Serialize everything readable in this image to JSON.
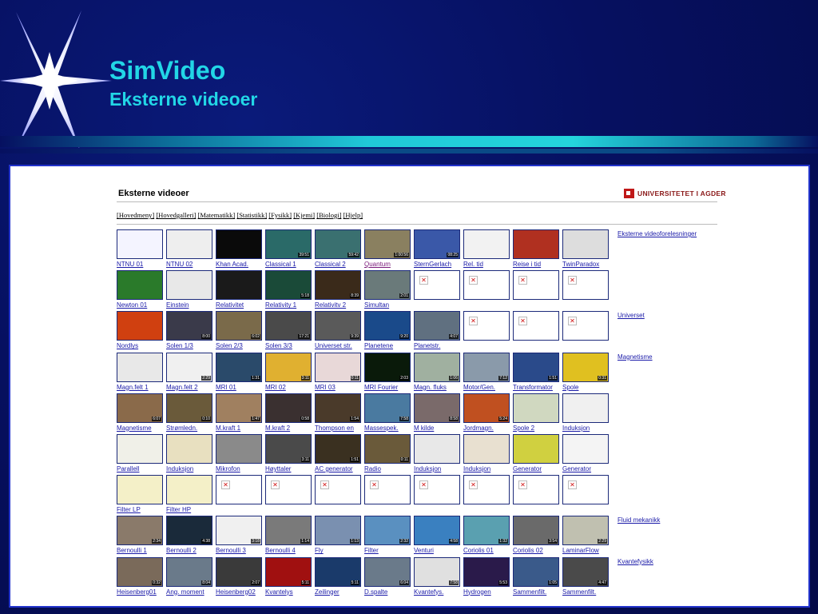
{
  "slide": {
    "title": "SimVideo",
    "subtitle": "Eksterne videoer"
  },
  "page": {
    "heading": "Eksterne videoer",
    "logo_text": "UNIVERSITETET I AGDER",
    "nav": [
      "[Hovedmeny]",
      "[Hovedgalleri]",
      "[Matematikk]",
      "[Statistikk]",
      "[Fysikk]",
      "[Kjemi]",
      "[Biologi]",
      "[Hjelp]"
    ]
  },
  "rows": [
    {
      "side": "Eksterne videoforelesninger",
      "items": [
        {
          "label": "NTNU 01",
          "bg": "#f4f4ff",
          "dur": ""
        },
        {
          "label": "NTNU 02",
          "bg": "#eeeeee",
          "dur": ""
        },
        {
          "label": "Khan Acad.",
          "bg": "#0a0a0a",
          "dur": ""
        },
        {
          "label": "Classical 1",
          "bg": "#2a6a68",
          "dur": "39:51"
        },
        {
          "label": "Classical 2",
          "bg": "#3a7070",
          "dur": "59:42"
        },
        {
          "label": "Quantum",
          "bg": "#8a8060",
          "dur": "1:00:56",
          "visited": true
        },
        {
          "label": "SternGerlach",
          "bg": "#3a58a8",
          "dur": "08:25"
        },
        {
          "label": "Rel. tid",
          "bg": "#f2f2f2",
          "dur": ""
        },
        {
          "label": "Reise i tid",
          "bg": "#b03020",
          "dur": ""
        },
        {
          "label": "TwinParadox",
          "bg": "#dddddd",
          "dur": ""
        }
      ]
    },
    {
      "side": "",
      "items": [
        {
          "label": "Newton 01",
          "bg": "#2a7a2a",
          "dur": ""
        },
        {
          "label": "Einstein",
          "bg": "#e8e8e8",
          "dur": ""
        },
        {
          "label": "Relativitet",
          "bg": "#1a1a1a",
          "dur": ""
        },
        {
          "label": "Relativity 1",
          "bg": "#1a4a38",
          "dur": "5:18"
        },
        {
          "label": "Relativitv 2",
          "bg": "#3a2a1a",
          "dur": "8:39"
        },
        {
          "label": "Simultan",
          "bg": "#6a7a7a",
          "dur": "2:01"
        },
        {
          "label": "",
          "bg": "",
          "dur": ""
        },
        {
          "label": "",
          "bg": "",
          "dur": ""
        },
        {
          "label": "",
          "bg": "",
          "dur": ""
        },
        {
          "label": "",
          "bg": "",
          "dur": ""
        }
      ]
    },
    {
      "side": "Universet",
      "items": [
        {
          "label": "Nordlys",
          "bg": "#d04010",
          "dur": ""
        },
        {
          "label": "Solen 1/3",
          "bg": "#3a3a4a",
          "dur": "8:00"
        },
        {
          "label": "Solen 2/3",
          "bg": "#7a6a4a",
          "dur": "6:02"
        },
        {
          "label": "Solen 3/3",
          "bg": "#4a4a4a",
          "dur": "17:21"
        },
        {
          "label": "Universet str.",
          "bg": "#5a5a5a",
          "dur": "9:39"
        },
        {
          "label": "Planetene",
          "bg": "#1a4a8a",
          "dur": "9:20"
        },
        {
          "label": "Planetstr.",
          "bg": "#607080",
          "dur": "4:07"
        },
        {
          "label": "",
          "bg": "",
          "dur": ""
        },
        {
          "label": "",
          "bg": "",
          "dur": ""
        },
        {
          "label": "",
          "bg": "",
          "dur": ""
        }
      ]
    },
    {
      "side": "Magnetisme",
      "items": [
        {
          "label": "Magn.felt 1",
          "bg": "#e8e8e8",
          "dur": ""
        },
        {
          "label": "Magn.felt 2",
          "bg": "#f0f0f0",
          "dur": "2:29"
        },
        {
          "label": "MRI 01",
          "bg": "#2a4a6a",
          "dur": "1:31"
        },
        {
          "label": "MRI 02",
          "bg": "#e0b030",
          "dur": "3:11"
        },
        {
          "label": "MRI 03",
          "bg": "#e8d8d8",
          "dur": "0:11"
        },
        {
          "label": "MRI Fourier",
          "bg": "#0a1a0a",
          "dur": "2:03"
        },
        {
          "label": "Magn. fluks",
          "bg": "#a0b0a0",
          "dur": "1:06"
        },
        {
          "label": "Motor/Gen.",
          "bg": "#8a9aaa",
          "dur": "7:12"
        },
        {
          "label": "Transformator",
          "bg": "#2a4a8a",
          "dur": "1:51"
        },
        {
          "label": "Spole",
          "bg": "#e0c020",
          "dur": "0:31"
        }
      ]
    },
    {
      "side": "",
      "items": [
        {
          "label": "Magnetisme",
          "bg": "#8a6a4a",
          "dur": "6:07"
        },
        {
          "label": "Strømledn.",
          "bg": "#6a5a3a",
          "dur": "0:10"
        },
        {
          "label": "M.kraft 1",
          "bg": "#a08060",
          "dur": "1:47"
        },
        {
          "label": "M.kraft 2",
          "bg": "#3a3030",
          "dur": "0:58"
        },
        {
          "label": "Thompson en",
          "bg": "#4a3a2a",
          "dur": "1:54"
        },
        {
          "label": "Massespek.",
          "bg": "#4a7aa0",
          "dur": "7:58"
        },
        {
          "label": "M kilde",
          "bg": "#7a6a6a",
          "dur": "8:58"
        },
        {
          "label": "Jordmagn.",
          "bg": "#c05020",
          "dur": "5:24"
        },
        {
          "label": "Spole 2",
          "bg": "#d0d8c0",
          "dur": ""
        },
        {
          "label": "Induksjon",
          "bg": "#f0f0f0",
          "dur": ""
        }
      ]
    },
    {
      "side": "",
      "items": [
        {
          "label": "Parallell",
          "bg": "#f0f0e8",
          "dur": ""
        },
        {
          "label": "Induksjon",
          "bg": "#e8e0c0",
          "dur": ""
        },
        {
          "label": "Mikrofon",
          "bg": "#8a8a8a",
          "dur": ""
        },
        {
          "label": "Høyttaler",
          "bg": "#4a4a4a",
          "dur": "3:11"
        },
        {
          "label": "AC generator",
          "bg": "#3a3020",
          "dur": "1:51"
        },
        {
          "label": "Radio",
          "bg": "#6a5a3a",
          "dur": "0:11"
        },
        {
          "label": "Induksjon",
          "bg": "#e8e8e8",
          "dur": ""
        },
        {
          "label": "Induksjon",
          "bg": "#e8e0d0",
          "dur": ""
        },
        {
          "label": "Generator",
          "bg": "#d0d040",
          "dur": ""
        },
        {
          "label": "Generator",
          "bg": "#f4f4f4",
          "dur": ""
        }
      ]
    },
    {
      "side": "",
      "items": [
        {
          "label": "Filter LP",
          "bg": "#f4f0c8",
          "dur": ""
        },
        {
          "label": "Filter HP",
          "bg": "#f4f0c8",
          "dur": ""
        },
        {
          "label": "",
          "bg": "",
          "dur": ""
        },
        {
          "label": "",
          "bg": "",
          "dur": ""
        },
        {
          "label": "",
          "bg": "",
          "dur": ""
        },
        {
          "label": "",
          "bg": "",
          "dur": ""
        },
        {
          "label": "",
          "bg": "",
          "dur": ""
        },
        {
          "label": "",
          "bg": "",
          "dur": ""
        },
        {
          "label": "",
          "bg": "",
          "dur": ""
        },
        {
          "label": "",
          "bg": "",
          "dur": ""
        }
      ]
    },
    {
      "side": "Fluid mekanikk",
      "items": [
        {
          "label": "Bernoulli 1",
          "bg": "#8a7a6a",
          "dur": "2:34"
        },
        {
          "label": "Bernoulli 2",
          "bg": "#1a2a3a",
          "dur": "4:38"
        },
        {
          "label": "Bernoulli 3",
          "bg": "#f0f0f0",
          "dur": "3:18"
        },
        {
          "label": "Bernoulli 4",
          "bg": "#7a7a7a",
          "dur": "1:14"
        },
        {
          "label": "Fly",
          "bg": "#7a90b0",
          "dur": "1:13"
        },
        {
          "label": "Filter",
          "bg": "#5a90c0",
          "dur": "2:32"
        },
        {
          "label": "Venturi",
          "bg": "#3a80c0",
          "dur": "4:58"
        },
        {
          "label": "Coriolis 01",
          "bg": "#5aa0b0",
          "dur": "1:32"
        },
        {
          "label": "Coriolis 02",
          "bg": "#6a6a6a",
          "dur": "3:54"
        },
        {
          "label": "LaminarFlow",
          "bg": "#c0c0b0",
          "dur": "2:29"
        }
      ]
    },
    {
      "side": "Kvantefysikk",
      "items": [
        {
          "label": "Heisenberg01",
          "bg": "#7a6a5a",
          "dur": "0:32"
        },
        {
          "label": "Ang. moment",
          "bg": "#6a7a8a",
          "dur": "8:04"
        },
        {
          "label": "Heisenberg02",
          "bg": "#3a3a3a",
          "dur": "2:07"
        },
        {
          "label": "Kvantelys",
          "bg": "#a01010",
          "dur": "5:11"
        },
        {
          "label": "Zeilinger",
          "bg": "#1a3a6a",
          "dur": "5:11"
        },
        {
          "label": "D.spalte",
          "bg": "#6a7a8a",
          "dur": "6:04"
        },
        {
          "label": "Kvantefys.",
          "bg": "#e0e0e0",
          "dur": "7:58"
        },
        {
          "label": "Hydrogen",
          "bg": "#2a1a4a",
          "dur": "5:53"
        },
        {
          "label": "Sammenfilt.",
          "bg": "#3a5a8a",
          "dur": "1:05"
        },
        {
          "label": "Sammenfilt.",
          "bg": "#4a4a4a",
          "dur": "4:47"
        }
      ]
    }
  ]
}
